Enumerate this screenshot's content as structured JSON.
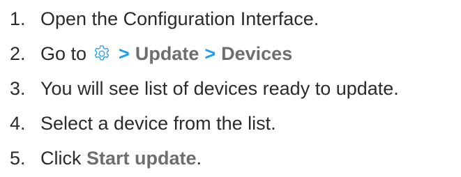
{
  "steps": [
    {
      "number": "1.",
      "text": "Open the Configuration Interface."
    },
    {
      "number": "2.",
      "prefix": "Go to",
      "icon": "gear-icon",
      "icon_color": "#1a9cf0",
      "separator": ">",
      "path": [
        "Update",
        "Devices"
      ]
    },
    {
      "number": "3.",
      "text": "You will see list of devices ready to update."
    },
    {
      "number": "4.",
      "text": "Select a device from the list."
    },
    {
      "number": "5.",
      "prefix": "Click",
      "action": "Start update",
      "suffix": "."
    }
  ]
}
